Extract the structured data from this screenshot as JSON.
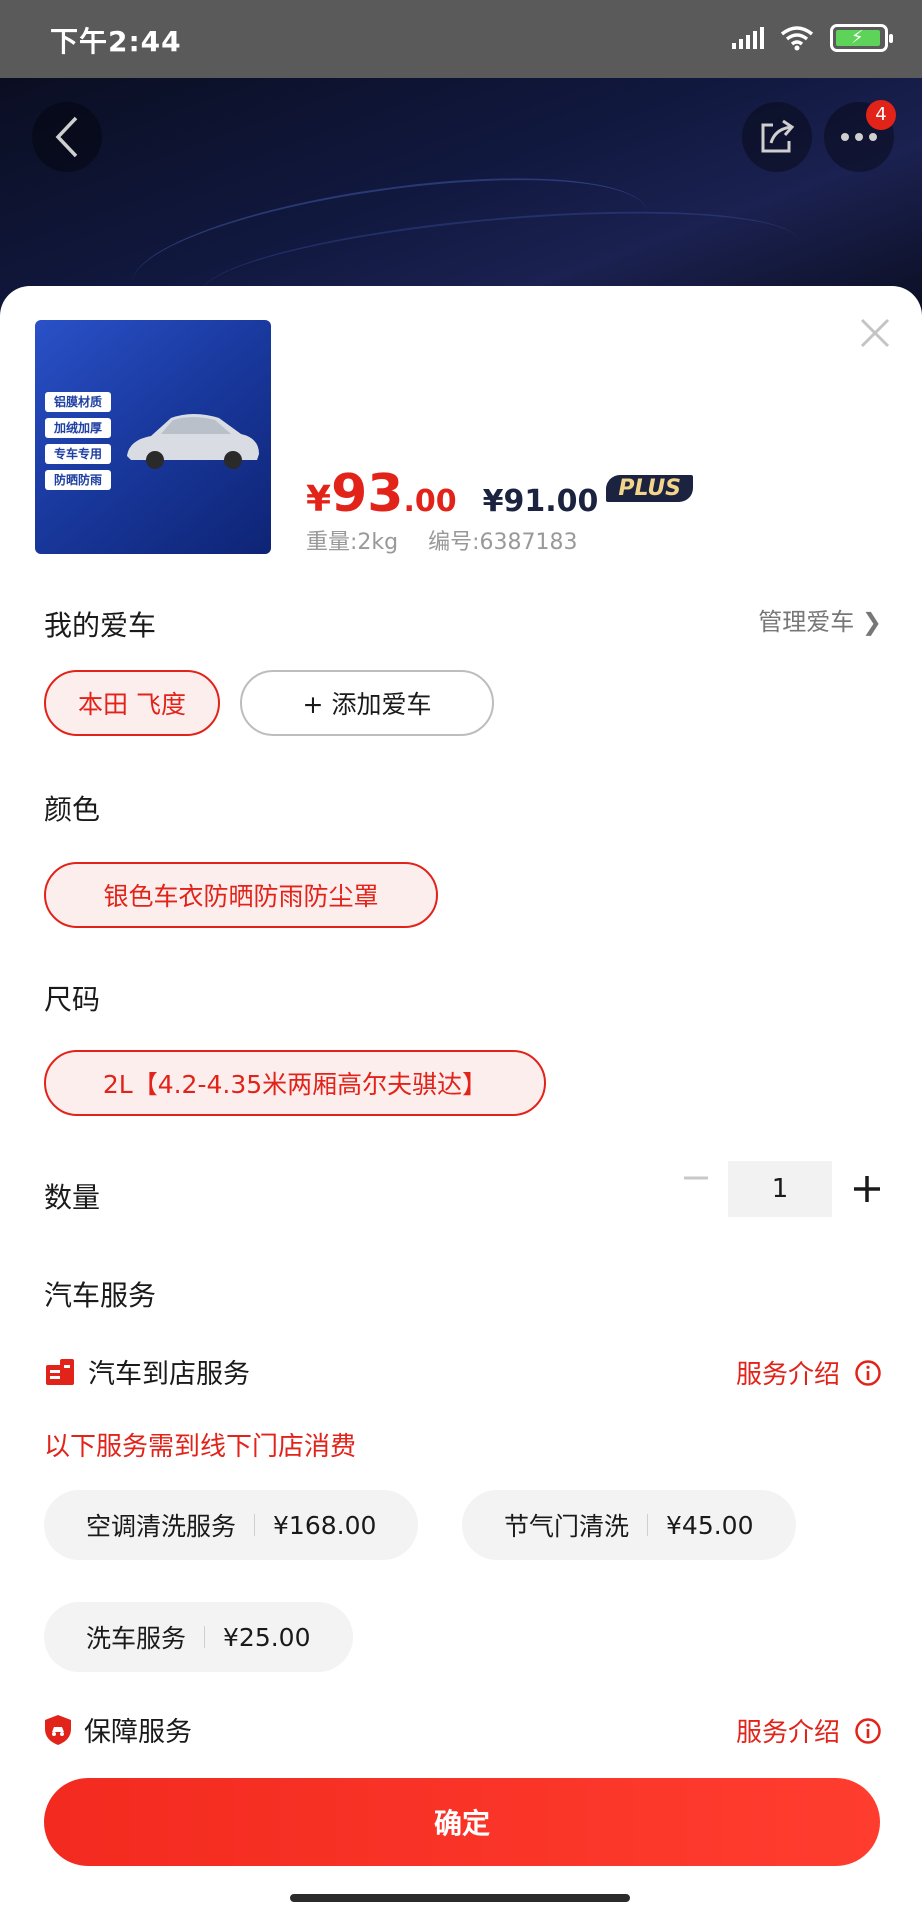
{
  "status_bar": {
    "time": "下午2:44"
  },
  "header": {
    "notification_count": "4"
  },
  "product": {
    "image_tags": [
      "铝膜材质",
      "加绒加厚",
      "专车专用",
      "防晒防雨"
    ],
    "price_symbol": "¥",
    "price_int": "93",
    "price_dec": ".00",
    "plus_price": "¥91.00",
    "plus_label": "PLUS",
    "weight": "重量:2kg",
    "sku": "编号:6387183"
  },
  "my_car": {
    "title": "我的爱车",
    "manage": "管理爱车 ❯",
    "selected": "本田 飞度",
    "add": "+ 添加爱车"
  },
  "color": {
    "title": "颜色",
    "option": "银色车衣防晒防雨防尘罩"
  },
  "size": {
    "title": "尺码",
    "option": "2L【4.2-4.35米两厢高尔夫骐达】"
  },
  "quantity": {
    "title": "数量",
    "value": "1"
  },
  "car_service": {
    "title": "汽车服务",
    "store_service": "汽车到店服务",
    "intro": "服务介绍",
    "notice": "以下服务需到线下门店消费",
    "items": [
      {
        "name": "空调清洗服务",
        "price": "¥168.00"
      },
      {
        "name": "节气门清洗",
        "price": "¥45.00"
      },
      {
        "name": "洗车服务",
        "price": "¥25.00"
      }
    ],
    "guarantee": "保障服务",
    "guarantee_intro": "服务介绍"
  },
  "confirm_label": "确定",
  "colors": {
    "accent": "#e2231a",
    "plus_dark": "#1b2340",
    "plus_gold": "#f2d48a"
  }
}
